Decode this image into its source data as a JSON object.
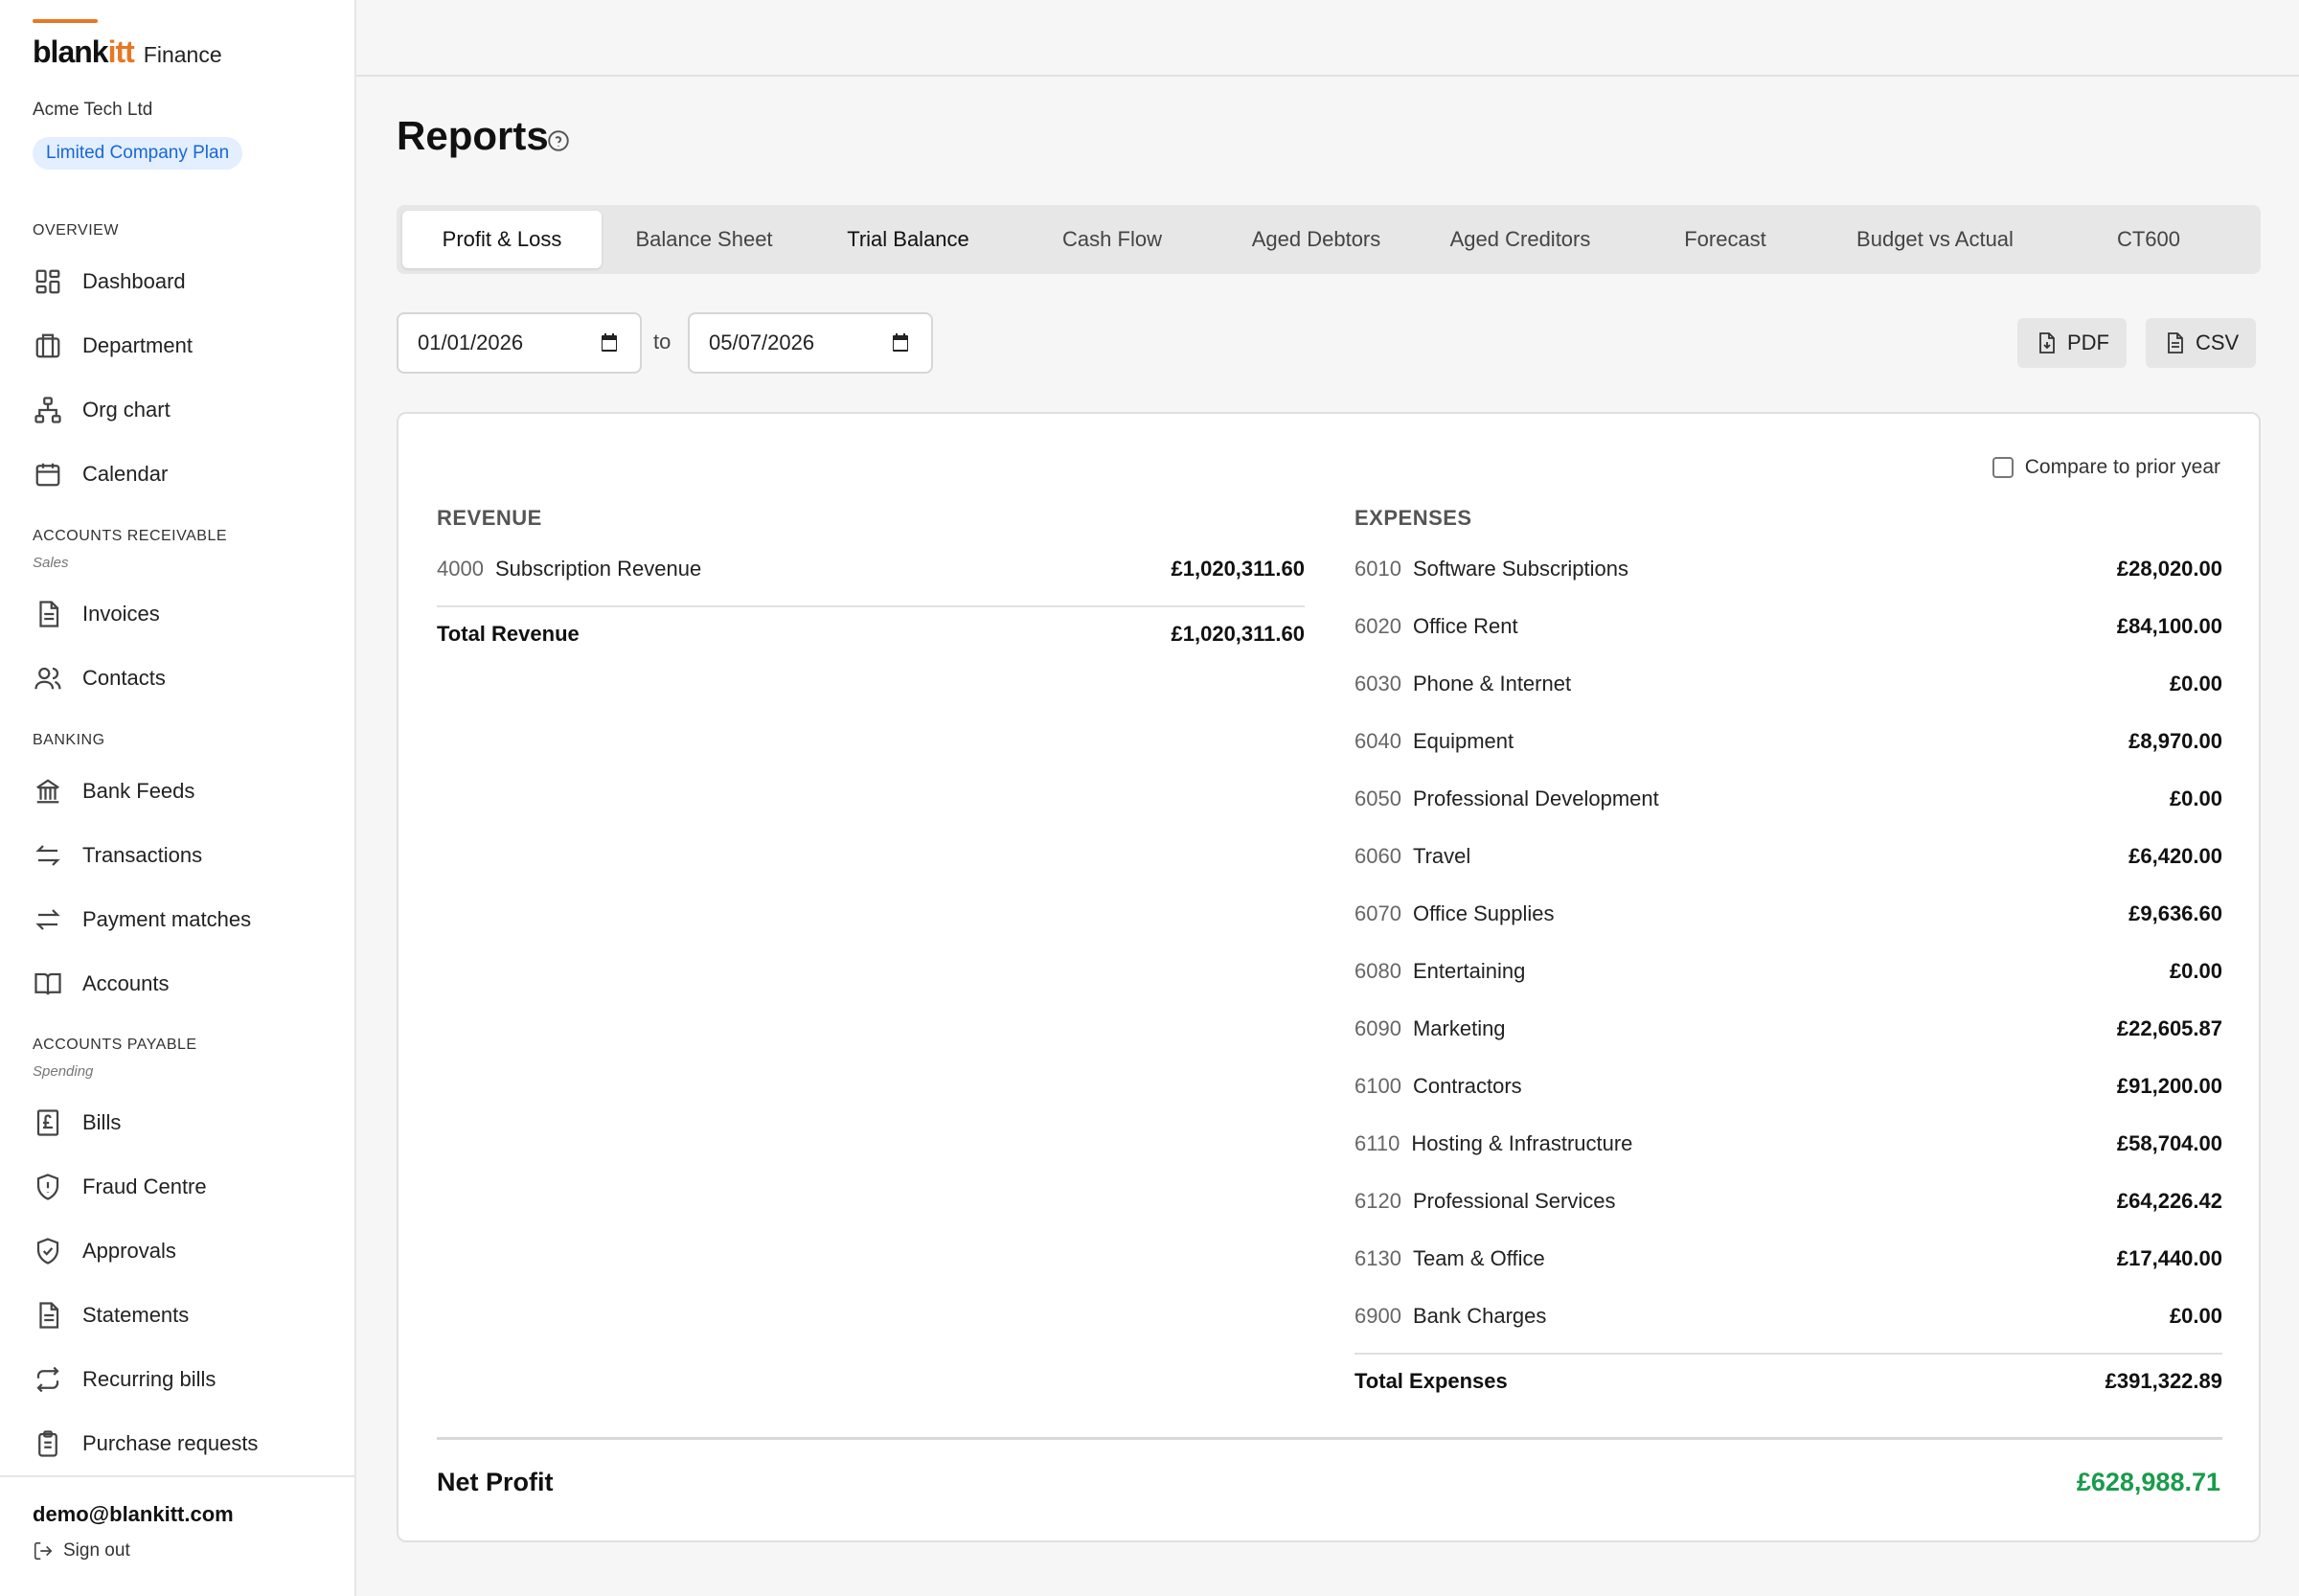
{
  "brand": {
    "name_part1": "blank",
    "name_part2": "itt",
    "product": "Finance"
  },
  "company": "Acme Tech Ltd",
  "plan": "Limited Company Plan",
  "sidebar": {
    "sections": [
      {
        "title": "OVERVIEW",
        "subtitle": ""
      },
      {
        "title": "ACCOUNTS RECEIVABLE",
        "subtitle": "Sales"
      },
      {
        "title": "BANKING",
        "subtitle": ""
      },
      {
        "title": "ACCOUNTS PAYABLE",
        "subtitle": "Spending"
      }
    ],
    "items": [
      {
        "label": "Dashboard",
        "icon": "dashboard-icon"
      },
      {
        "label": "Department",
        "icon": "building-icon"
      },
      {
        "label": "Org chart",
        "icon": "org-chart-icon"
      },
      {
        "label": "Calendar",
        "icon": "calendar-icon"
      },
      {
        "label": "Invoices",
        "icon": "document-icon"
      },
      {
        "label": "Contacts",
        "icon": "users-icon"
      },
      {
        "label": "Bank Feeds",
        "icon": "bank-icon"
      },
      {
        "label": "Transactions",
        "icon": "arrows-icon"
      },
      {
        "label": "Payment matches",
        "icon": "swap-icon"
      },
      {
        "label": "Accounts",
        "icon": "book-icon"
      },
      {
        "label": "Bills",
        "icon": "pound-receipt-icon"
      },
      {
        "label": "Fraud Centre",
        "icon": "shield-alert-icon"
      },
      {
        "label": "Approvals",
        "icon": "shield-check-icon"
      },
      {
        "label": "Statements",
        "icon": "document-icon"
      },
      {
        "label": "Recurring bills",
        "icon": "repeat-icon"
      },
      {
        "label": "Purchase requests",
        "icon": "clipboard-icon"
      }
    ]
  },
  "user": {
    "email": "demo@blankitt.com",
    "signout": "Sign out"
  },
  "page": {
    "title": "Reports"
  },
  "tabs": [
    {
      "label": "Profit & Loss"
    },
    {
      "label": "Balance Sheet"
    },
    {
      "label": "Trial Balance"
    },
    {
      "label": "Cash Flow"
    },
    {
      "label": "Aged Debtors"
    },
    {
      "label": "Aged Creditors"
    },
    {
      "label": "Forecast"
    },
    {
      "label": "Budget vs Actual"
    },
    {
      "label": "CT600"
    }
  ],
  "filters": {
    "date_from": "01/01/2026",
    "to_label": "to",
    "date_to": "05/07/2026"
  },
  "export": {
    "pdf": "PDF",
    "csv": "CSV"
  },
  "report": {
    "compare_label": "Compare to prior year",
    "revenue": {
      "heading": "REVENUE",
      "rows": [
        {
          "code": "4000",
          "name": "Subscription Revenue",
          "amount": "£1,020,311.60"
        }
      ],
      "total_label": "Total Revenue",
      "total": "£1,020,311.60"
    },
    "expenses": {
      "heading": "EXPENSES",
      "rows": [
        {
          "code": "6010",
          "name": "Software Subscriptions",
          "amount": "£28,020.00"
        },
        {
          "code": "6020",
          "name": "Office Rent",
          "amount": "£84,100.00"
        },
        {
          "code": "6030",
          "name": "Phone & Internet",
          "amount": "£0.00"
        },
        {
          "code": "6040",
          "name": "Equipment",
          "amount": "£8,970.00"
        },
        {
          "code": "6050",
          "name": "Professional Development",
          "amount": "£0.00"
        },
        {
          "code": "6060",
          "name": "Travel",
          "amount": "£6,420.00"
        },
        {
          "code": "6070",
          "name": "Office Supplies",
          "amount": "£9,636.60"
        },
        {
          "code": "6080",
          "name": "Entertaining",
          "amount": "£0.00"
        },
        {
          "code": "6090",
          "name": "Marketing",
          "amount": "£22,605.87"
        },
        {
          "code": "6100",
          "name": "Contractors",
          "amount": "£91,200.00"
        },
        {
          "code": "6110",
          "name": "Hosting & Infrastructure",
          "amount": "£58,704.00"
        },
        {
          "code": "6120",
          "name": "Professional Services",
          "amount": "£64,226.42"
        },
        {
          "code": "6130",
          "name": "Team & Office",
          "amount": "£17,440.00"
        },
        {
          "code": "6900",
          "name": "Bank Charges",
          "amount": "£0.00"
        }
      ],
      "total_label": "Total Expenses",
      "total": "£391,322.89"
    },
    "net_label": "Net Profit",
    "net_value": "£628,988.71"
  },
  "colors": {
    "accent": "#e87722",
    "plan_bg": "#e3efff",
    "plan_text": "#1a66d6",
    "net_profit": "#1a9b4b"
  }
}
